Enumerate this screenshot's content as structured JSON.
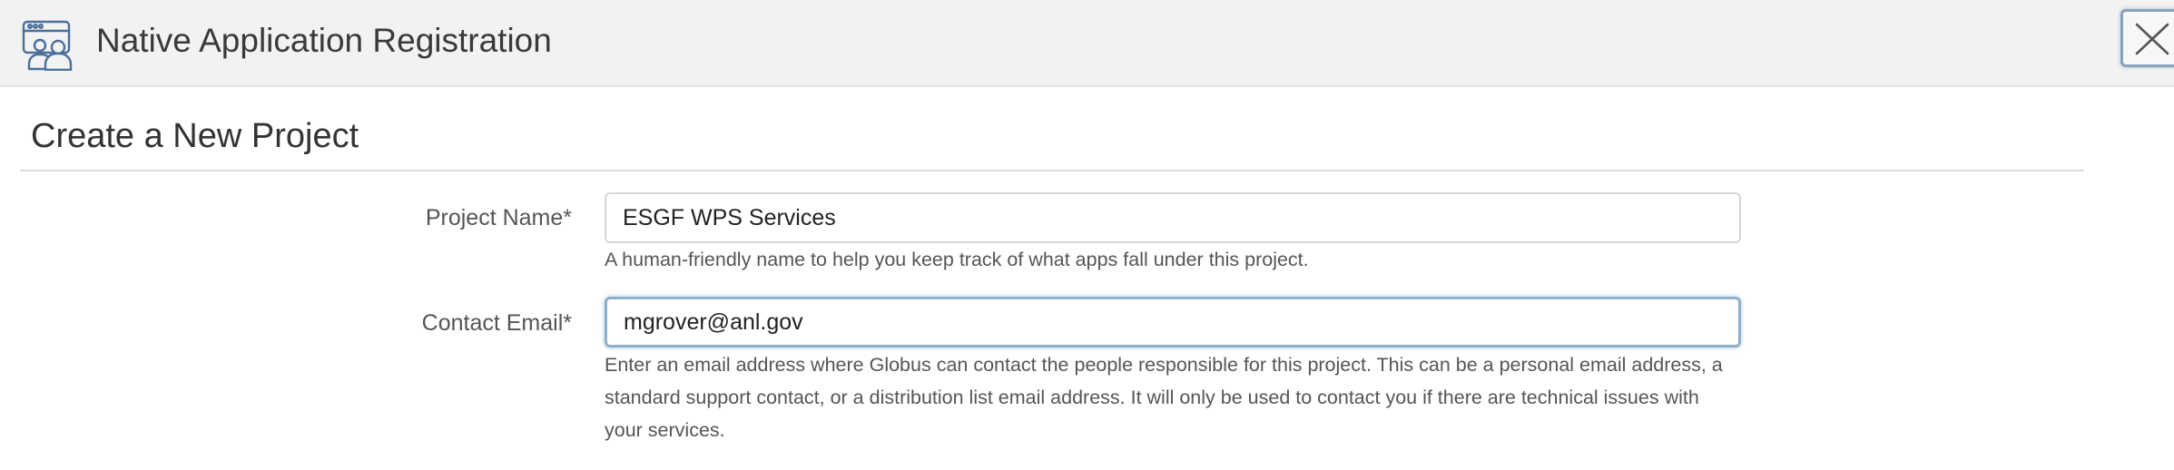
{
  "header": {
    "title": "Native Application Registration",
    "icon": "app-users-icon",
    "close_icon": "close-icon"
  },
  "section": {
    "title": "Create a New Project"
  },
  "form": {
    "project_name": {
      "label": "Project Name*",
      "value": "ESGF WPS Services",
      "help": "A human-friendly name to help you keep track of what apps fall under this project."
    },
    "contact_email": {
      "label": "Contact Email*",
      "value": "mgrover@anl.gov",
      "help_lines": [
        "Enter an email address where Globus can contact the people responsible for this project. This can be a personal email address, a",
        "standard support contact, or a distribution list email address. It will only be used to contact you if there are technical issues with",
        "your services."
      ]
    }
  },
  "colors": {
    "header_bg": "#f2f2f2",
    "icon_stroke": "#4a6f9a",
    "focus_border": "#8eb0cc"
  }
}
